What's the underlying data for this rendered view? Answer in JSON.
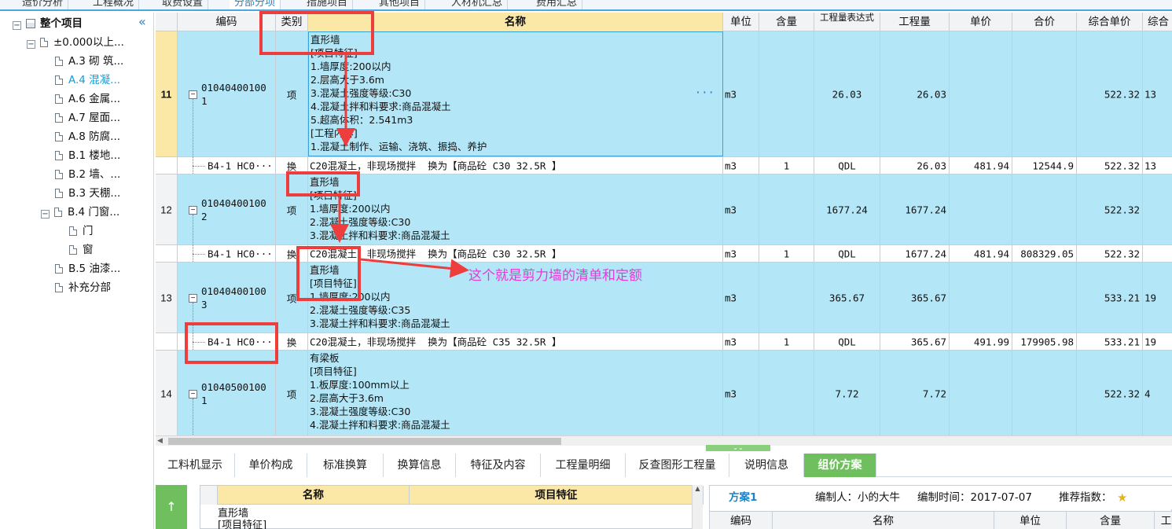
{
  "top_tabs": [
    "造价分析",
    "工程概况",
    "取费设置",
    "分部分项",
    "措施项目",
    "其他项目",
    "人材机汇总",
    "费用汇总"
  ],
  "active_top_tab": 3,
  "tree": {
    "root": "整个项目",
    "nodes": [
      {
        "label": "±0.000以上...",
        "level": 1,
        "expandable": true
      },
      {
        "label": "A.3 砌 筑...",
        "level": 2
      },
      {
        "label": "A.4 混凝...",
        "level": 2,
        "selected": true
      },
      {
        "label": "A.6 金属...",
        "level": 2
      },
      {
        "label": "A.7 屋面...",
        "level": 2
      },
      {
        "label": "A.8 防腐...",
        "level": 2
      },
      {
        "label": "B.1 楼地...",
        "level": 2
      },
      {
        "label": "B.2 墙、...",
        "level": 2
      },
      {
        "label": "B.3 天棚...",
        "level": 2
      },
      {
        "label": "B.4 门窗...",
        "level": 2,
        "expandable": true
      },
      {
        "label": "门",
        "level": 3
      },
      {
        "label": "窗",
        "level": 3
      },
      {
        "label": "B.5 油漆...",
        "level": 2
      },
      {
        "label": "补充分部",
        "level": 2
      }
    ]
  },
  "grid": {
    "headers": [
      "",
      "编码",
      "类别",
      "名称",
      "单位",
      "含量",
      "工程量表达式",
      "工程量",
      "单价",
      "合价",
      "综合单价",
      "综合"
    ],
    "rows": [
      {
        "type": "item",
        "num": "11",
        "selected": true,
        "code": "01040400100\n1",
        "kind": "项",
        "name": "直形墙\n[项目特征]\n1.墙厚度:200以内\n2.层高大于3.6m\n3.混凝土强度等级:C30\n4.混凝土拌和料要求:商品混凝土\n5.超高体积：2.541m3\n[工程内容]\n1.混凝土制作、运输、浇筑、振捣、养护",
        "unit": "m3",
        "content": "",
        "expr": "26.03",
        "qty": "26.03",
        "price": "",
        "total": "",
        "comp": "522.32",
        "comp2": "13"
      },
      {
        "type": "quota",
        "code": "B4-1 HC0···",
        "kind": "换",
        "name": "C20混凝土，非现场搅拌  换为【商品砼 C30 32.5R 】",
        "unit": "m3",
        "content": "1",
        "expr": "QDL",
        "qty": "26.03",
        "price": "481.94",
        "total": "12544.9",
        "comp": "522.32",
        "comp2": "13"
      },
      {
        "type": "item",
        "num": "12",
        "code": "01040400100\n2",
        "kind": "项",
        "name": "直形墙\n[项目特征]\n1.墙厚度:200以内\n2.混凝土强度等级:C30\n3.混凝土拌和料要求:商品混凝土",
        "unit": "m3",
        "content": "",
        "expr": "1677.24",
        "qty": "1677.24",
        "price": "",
        "total": "",
        "comp": "522.32",
        "comp2": ""
      },
      {
        "type": "quota",
        "code": "B4-1 HC0···",
        "kind": "换",
        "name": "C20混凝土，非现场搅拌  换为【商品砼 C30 32.5R 】",
        "unit": "m3",
        "content": "1",
        "expr": "QDL",
        "qty": "1677.24",
        "price": "481.94",
        "total": "808329.05",
        "comp": "522.32",
        "comp2": ""
      },
      {
        "type": "item",
        "num": "13",
        "code": "01040400100\n3",
        "kind": "项",
        "name": "直形墙\n[项目特征]\n1.墙厚度:200以内\n2.混凝土强度等级:C35\n3.混凝土拌和料要求:商品混凝土",
        "unit": "m3",
        "content": "",
        "expr": "365.67",
        "qty": "365.67",
        "price": "",
        "total": "",
        "comp": "533.21",
        "comp2": "19"
      },
      {
        "type": "quota",
        "code": "B4-1 HC0···",
        "kind": "换",
        "name": "C20混凝土，非现场搅拌  换为【商品砼 C35 32.5R 】",
        "unit": "m3",
        "content": "1",
        "expr": "QDL",
        "qty": "365.67",
        "price": "491.99",
        "total": "179905.98",
        "comp": "533.21",
        "comp2": "19"
      },
      {
        "type": "item",
        "num": "14",
        "code": "01040500100\n1",
        "kind": "项",
        "name": "有梁板\n[项目特征]\n1.板厚度:100mm以上\n2.层高大于3.6m\n3.混凝土强度等级:C30\n4.混凝土拌和料要求:商品混凝土",
        "unit": "m3",
        "content": "",
        "expr": "7.72",
        "qty": "7.72",
        "price": "",
        "total": "",
        "comp": "522.32",
        "comp2": "4"
      }
    ]
  },
  "bottom_tabs": [
    "工料机显示",
    "单价构成",
    "标准换算",
    "换算信息",
    "特征及内容",
    "工程量明细",
    "反查图形工程量",
    "说明信息",
    "组价方案"
  ],
  "active_bottom_tab": 8,
  "lower_left": {
    "headers": [
      "名称",
      "项目特征"
    ],
    "text": "直形墙\n[项目特征]"
  },
  "lower_right": {
    "plan": "方案1",
    "author_label": "编制人：小的大牛",
    "time_label": "编制时间：2017-07-07",
    "rating_label": "推荐指数：",
    "headers": [
      "编码",
      "名称",
      "单位",
      "含量",
      "工"
    ]
  },
  "annotation": {
    "text": "这个就是剪力墙的清单和定额",
    "color": "#e13ad8",
    "box_color": "#ee3d3d"
  }
}
